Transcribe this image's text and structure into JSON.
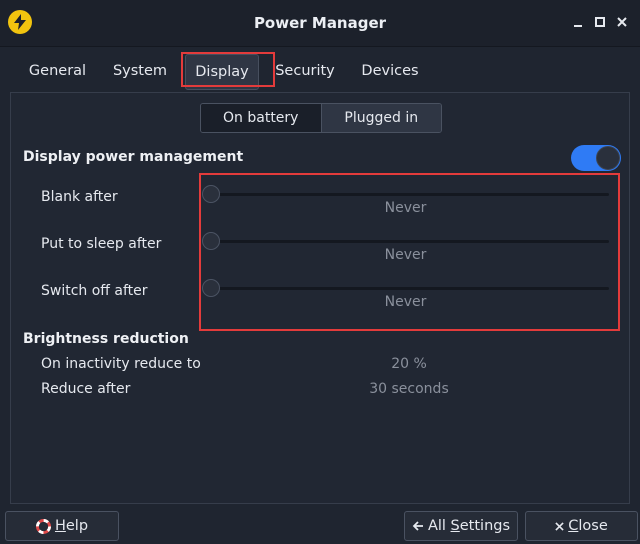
{
  "window": {
    "title": "Power Manager"
  },
  "tabs": [
    {
      "label": "General"
    },
    {
      "label": "System"
    },
    {
      "label": "Display",
      "active": true
    },
    {
      "label": "Security"
    },
    {
      "label": "Devices"
    }
  ],
  "power_source": {
    "options": [
      "On battery",
      "Plugged in"
    ],
    "selected": "On battery"
  },
  "display_power_management": {
    "title": "Display power management",
    "enabled": true,
    "rows": [
      {
        "label": "Blank after",
        "value": "Never",
        "level": 0
      },
      {
        "label": "Put to sleep after",
        "value": "Never",
        "level": 0
      },
      {
        "label": "Switch off after",
        "value": "Never",
        "level": 0
      }
    ]
  },
  "brightness_reduction": {
    "title": "Brightness reduction",
    "rows": [
      {
        "label": "On inactivity reduce to",
        "value": "20 %"
      },
      {
        "label": "Reduce after",
        "value": "30 seconds"
      }
    ]
  },
  "footer": {
    "help_mnemonic": "H",
    "help_rest": "elp",
    "all_settings_prefix": "All ",
    "all_settings_mnemonic": "S",
    "all_settings_rest": "ettings",
    "close_mnemonic": "C",
    "close_rest": "lose"
  },
  "colors": {
    "accent": "#2f7bf5",
    "highlight": "#e33b3b",
    "app_icon": "#f1c40f"
  }
}
